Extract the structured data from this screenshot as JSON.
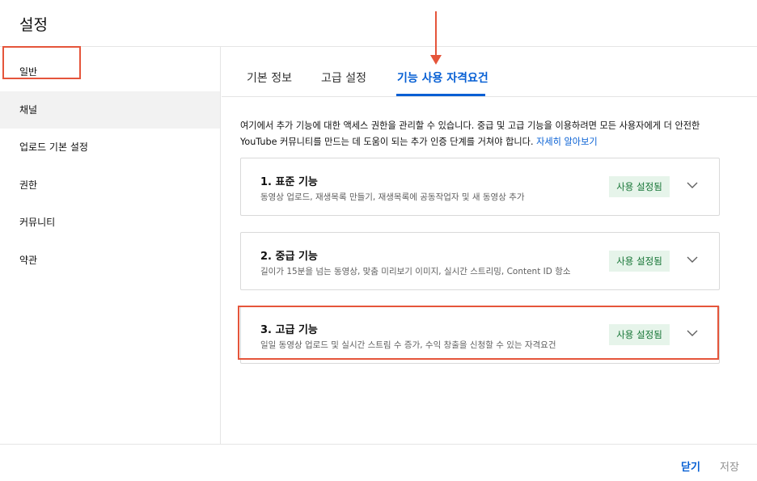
{
  "header": {
    "title": "설정"
  },
  "sidebar": {
    "items": [
      {
        "label": "일반"
      },
      {
        "label": "채널"
      },
      {
        "label": "업로드 기본 설정"
      },
      {
        "label": "권한"
      },
      {
        "label": "커뮤니티"
      },
      {
        "label": "약관"
      }
    ],
    "active_index": 1
  },
  "tabs": [
    {
      "label": "기본 정보"
    },
    {
      "label": "고급 설정"
    },
    {
      "label": "기능 사용 자격요건"
    }
  ],
  "intro": {
    "text": "여기에서 추가 기능에 대한 액세스 권한을 관리할 수 있습니다. 중급 및 고급 기능을 이용하려면 모든 사용자에게 더 안전한 YouTube 커뮤니티를 만드는 데 도움이 되는 추가 인증 단계를 거쳐야 합니다.",
    "link": "자세히 알아보기"
  },
  "cards": [
    {
      "title": "1. 표준 기능",
      "desc": "동영상 업로드, 재생목록 만들기, 재생목록에 공동작업자 및 새 동영상 추가",
      "badge": "사용 설정됨"
    },
    {
      "title": "2. 중급 기능",
      "desc": "길이가 15분을 넘는 동영상, 맞춤 미리보기 이미지, 실시간 스트리밍, Content ID 항소",
      "badge": "사용 설정됨"
    },
    {
      "title": "3. 고급 기능",
      "desc": "일일 동영상 업로드 및 실시간 스트림 수 증가, 수익 창출을 신청할 수 있는 자격요건",
      "badge": "사용 설정됨"
    }
  ],
  "footer": {
    "close_label": "닫기",
    "save_label": "저장"
  },
  "colors": {
    "accent": "#065fd4",
    "annotation": "#e5553b",
    "badge_bg": "#e6f4ea",
    "badge_text": "#137333"
  },
  "icons": {
    "card_expand": "chevron-down-icon"
  }
}
